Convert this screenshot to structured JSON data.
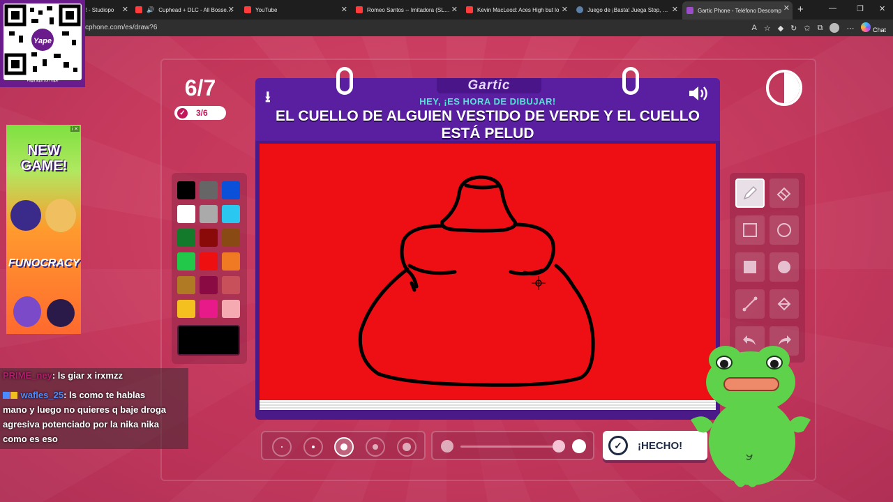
{
  "browser": {
    "tabs": [
      {
        "title": "n! - Studiopo",
        "color": "#ff3b3b"
      },
      {
        "title": "Cuphead + DLC - All Bosses S",
        "color": "#ff3b3b"
      },
      {
        "title": "YouTube",
        "color": "#ff3b3b"
      },
      {
        "title": "Romeo Santos -- Imitadora (SLOW",
        "color": "#ff3b3b"
      },
      {
        "title": "Kevin MacLeod: Aces High but lo",
        "color": "#ff3b3b"
      },
      {
        "title": "Juego de ¡Basta! Juega Stop, Tutti",
        "color": "#5b7fa8"
      },
      {
        "title": "Gartic Phone - Teléfono Descomp",
        "color": "#9b4dca"
      }
    ],
    "url": "cphone.com/es/draw?6",
    "chat_label": "Chat"
  },
  "game": {
    "round": "6/7",
    "progress": "3/6",
    "logo": "Gartic",
    "hey_text": "HEY, ¡ES HORA DE DIBUJAR!",
    "prompt_line1": "EL CUELLO DE ALGUIEN VESTIDO DE VERDE Y EL CUELLO",
    "prompt_line2": "ESTÁ PELUD",
    "done_label": "¡HECHO!",
    "canvas_color": "#ee0f14",
    "selected_color": "#000000",
    "palette": [
      "#000000",
      "#666666",
      "#0a50d8",
      "#ffffff",
      "#aaaaaa",
      "#2ac8f0",
      "#127a2a",
      "#8a0a0a",
      "#8a4a14",
      "#22c84a",
      "#ee1010",
      "#f07a24",
      "#b07a24",
      "#8a0a44",
      "#c8505a",
      "#f4c020",
      "#e81a8a",
      "#f4aab0"
    ],
    "tools": [
      "pencil-tool",
      "eraser-tool",
      "rectangle-outline-tool",
      "ellipse-outline-tool",
      "rectangle-fill-tool",
      "ellipse-fill-tool",
      "line-tool",
      "bucket-tool",
      "undo-tool",
      "redo-tool"
    ]
  },
  "overlays": {
    "qr_caption": "Paga aquí con Yape",
    "ad_title": "NEW GAME!",
    "ad_brand": "FUNOCRACY",
    "chat": [
      {
        "user": "PRIME_ney",
        "message": ": ls giar x irxmzz"
      },
      {
        "user": "wafles_25",
        "message": ": ls como te hablas"
      },
      {
        "user": "",
        "message": "mano y luego no quieres q baje droga"
      },
      {
        "user": "",
        "message": "agresiva potenciado por la nika nika"
      },
      {
        "user": "",
        "message": "como es eso"
      }
    ]
  }
}
